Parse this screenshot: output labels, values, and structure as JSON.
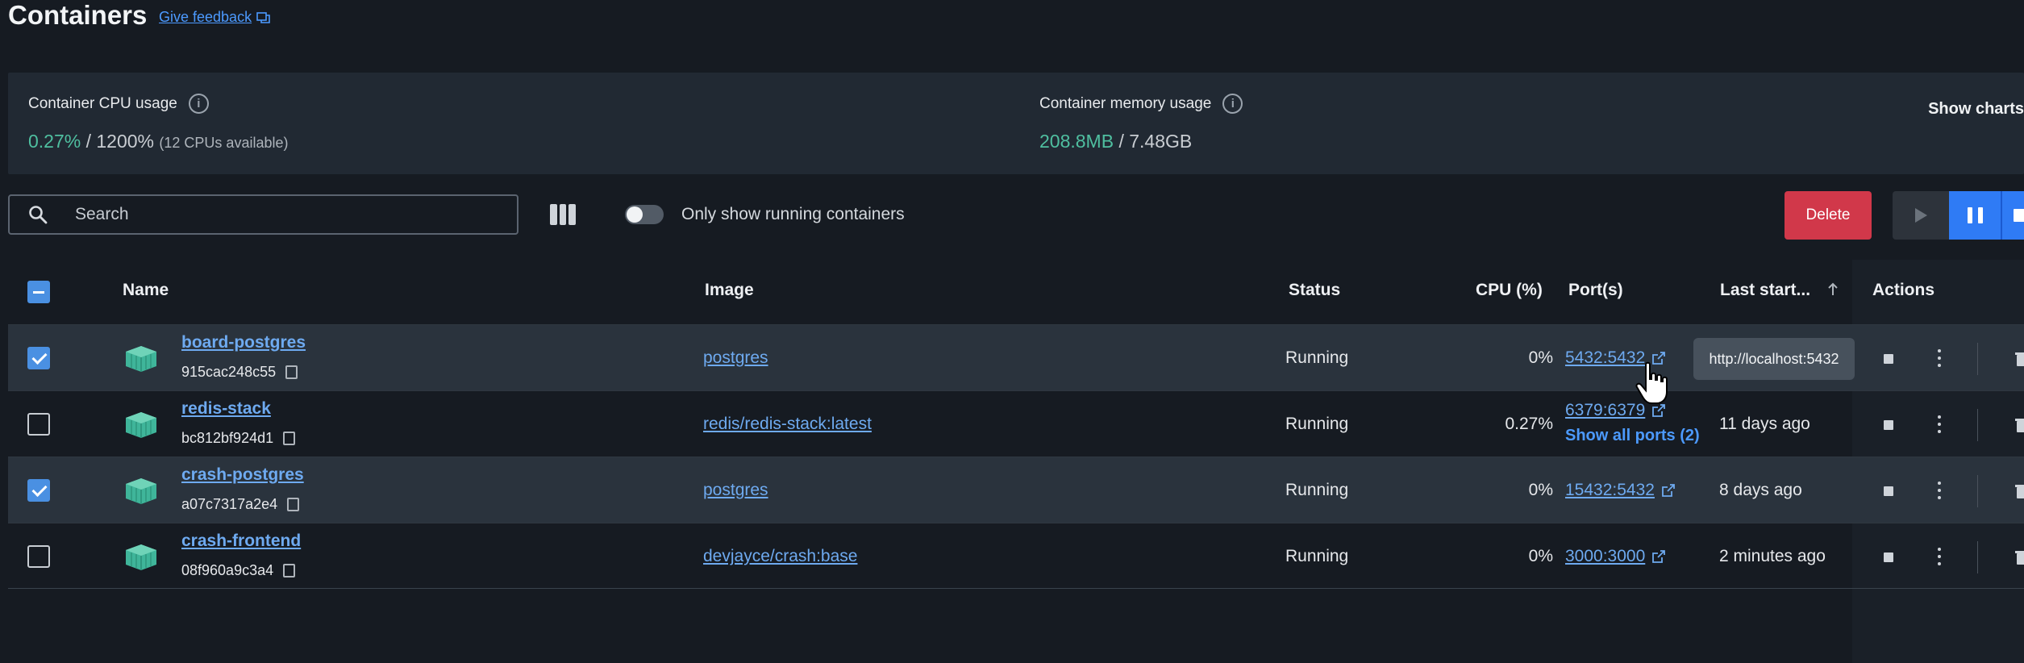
{
  "header": {
    "title": "Containers",
    "feedback_label": "Give feedback"
  },
  "usage": {
    "cpu": {
      "label": "Container CPU usage",
      "value": "0.27%",
      "separator": " / ",
      "total": "1200%",
      "sub": "(12 CPUs available)"
    },
    "memory": {
      "label": "Container memory usage",
      "value": "208.8MB",
      "separator": " / ",
      "total": "7.48GB"
    },
    "show_charts_label": "Show charts"
  },
  "toolbar": {
    "search_placeholder": "Search",
    "toggle_label": "Only show running containers",
    "delete_label": "Delete"
  },
  "table": {
    "columns": {
      "name": "Name",
      "image": "Image",
      "status": "Status",
      "cpu": "CPU (%)",
      "ports": "Port(s)",
      "last_started": "Last start...",
      "actions": "Actions"
    },
    "rows": [
      {
        "selected": true,
        "name": "board-postgres",
        "id": "915cac248c55",
        "image": "postgres",
        "status": "Running",
        "cpu": "0%",
        "port": "5432:5432",
        "last_started": ""
      },
      {
        "selected": false,
        "name": "redis-stack",
        "id": "bc812bf924d1",
        "image": "redis/redis-stack:latest",
        "status": "Running",
        "cpu": "0.27%",
        "port": "6379:6379",
        "show_ports": "Show all ports (2)",
        "last_started": "11 days ago"
      },
      {
        "selected": true,
        "name": "crash-postgres",
        "id": "a07c7317a2e4",
        "image": "postgres",
        "status": "Running",
        "cpu": "0%",
        "port": "15432:5432",
        "last_started": "8 days ago"
      },
      {
        "selected": false,
        "name": "crash-frontend",
        "id": "08f960a9c3a4",
        "image": "devjayce/crash:base",
        "status": "Running",
        "cpu": "0%",
        "port": "3000:3000",
        "last_started": "2 minutes ago"
      }
    ]
  },
  "tooltip": {
    "text": "http://localhost:5432"
  },
  "colors": {
    "accent_green": "#4fbfa0",
    "link_blue": "#6eaaf0",
    "delete_red": "#d1384a",
    "primary_blue": "#2f7bf5"
  }
}
